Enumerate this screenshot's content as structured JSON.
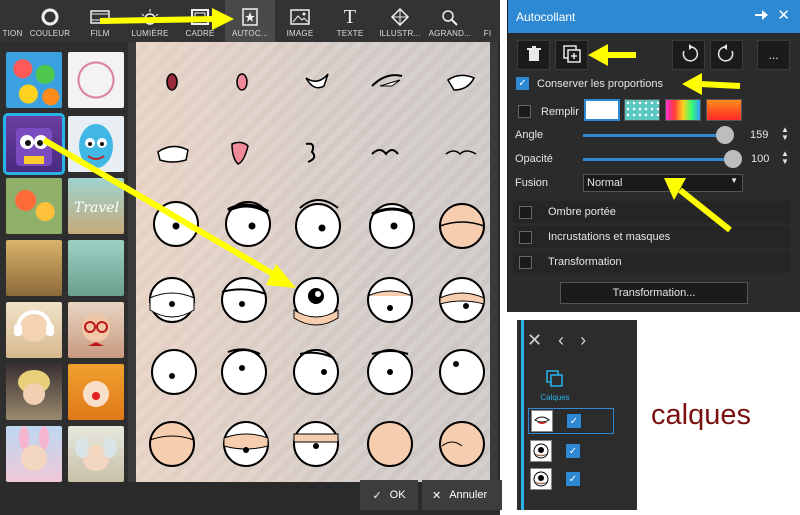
{
  "toolbar": {
    "items": [
      {
        "label": "TION",
        "icon": "partial-icon"
      },
      {
        "label": "COULEUR",
        "icon": "circle-icon"
      },
      {
        "label": "FILM",
        "icon": "film-icon"
      },
      {
        "label": "LUMIÈRE",
        "icon": "sun-icon"
      },
      {
        "label": "CADRE",
        "icon": "frame-icon"
      },
      {
        "label": "AUTOC...",
        "icon": "sticker-icon"
      },
      {
        "label": "IMAGE",
        "icon": "image-icon"
      },
      {
        "label": "TEXTE",
        "icon": "text-icon"
      },
      {
        "label": "ILLUSTR...",
        "icon": "shapes-icon"
      },
      {
        "label": "AGRAND...",
        "icon": "zoom-icon"
      },
      {
        "label": "FI",
        "icon": "partial-icon"
      }
    ]
  },
  "footer": {
    "ok_label": "OK",
    "cancel_label": "Annuler"
  },
  "panel": {
    "title": "Autocollant",
    "tools": [
      "trash-icon",
      "add-layer-icon",
      "rotate-left-icon",
      "rotate-right-icon",
      "more-icon"
    ],
    "more_label": "...",
    "keep_proportions": "Conserver les proportions",
    "fill_label": "Remplir",
    "angle_label": "Angle",
    "angle_value": "159",
    "opacity_label": "Opacité",
    "opacity_value": "100",
    "blend_label": "Fusion",
    "blend_value": "Normal",
    "sections": [
      "Ombre portée",
      "Incrustations et masques",
      "Transformation"
    ],
    "transform_button": "Transformation..."
  },
  "layers": {
    "tab_label": "Calques"
  },
  "annotation": {
    "text": "calques"
  },
  "colors": {
    "accent": "#2d89d3",
    "selection": "#27b3e8",
    "arrow": "#ffff00",
    "annotation": "#7a1010"
  }
}
